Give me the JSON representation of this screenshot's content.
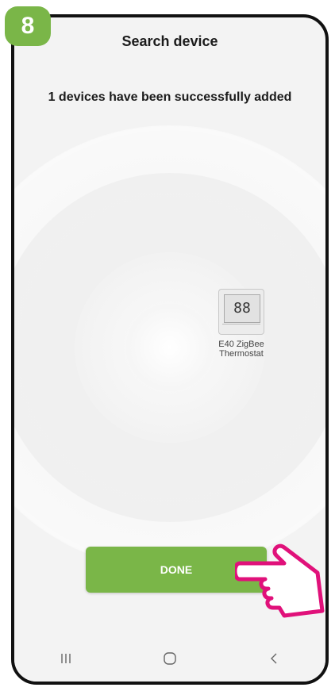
{
  "step": {
    "number": "8"
  },
  "header": {
    "title": "Search device"
  },
  "status": {
    "message": "1 devices have been successfully added"
  },
  "device": {
    "icon": "thermostat-icon",
    "screen_text": "88",
    "name_line1": "E40 ZigBee",
    "name_line2": "Thermostat"
  },
  "actions": {
    "done_label": "DONE"
  },
  "navbar": {
    "items": [
      {
        "icon": "recent-apps-icon"
      },
      {
        "icon": "home-icon"
      },
      {
        "icon": "back-icon"
      }
    ]
  },
  "colors": {
    "accent": "#7ab648",
    "pointer": "#e0117a",
    "background": "#f3f3f3"
  }
}
